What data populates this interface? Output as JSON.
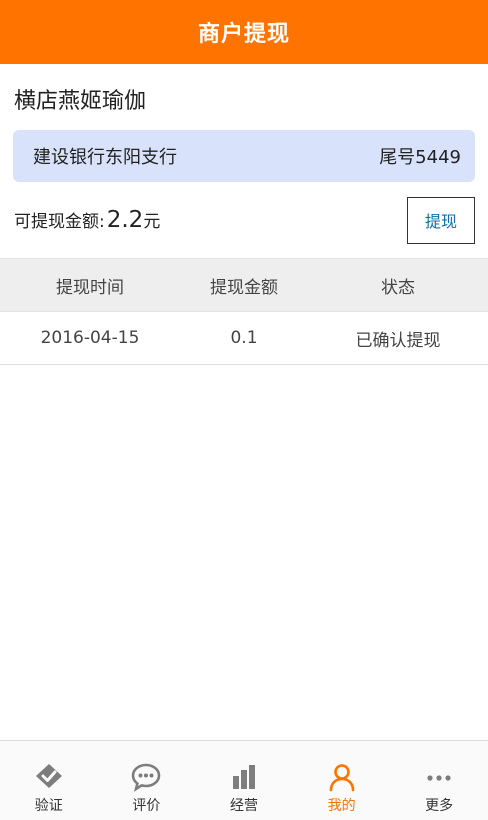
{
  "header": {
    "title": "商户提现"
  },
  "merchant": {
    "name": "横店燕姬瑜伽"
  },
  "bank": {
    "name": "建设银行东阳支行",
    "tail": "尾号5449"
  },
  "balance": {
    "label": "可提现金额:",
    "amount": "2.2",
    "unit": "元",
    "button_label": "提现"
  },
  "table": {
    "columns": [
      "提现时间",
      "提现金额",
      "状态"
    ],
    "rows": [
      {
        "time": "2016-04-15",
        "amount": "0.1",
        "status": "已确认提现"
      }
    ]
  },
  "tabbar": {
    "items": [
      {
        "label": "验证",
        "icon": "verify-icon",
        "active": false
      },
      {
        "label": "评价",
        "icon": "comment-icon",
        "active": false
      },
      {
        "label": "经营",
        "icon": "bar-chart-icon",
        "active": false
      },
      {
        "label": "我的",
        "icon": "person-icon",
        "active": true
      },
      {
        "label": "更多",
        "icon": "more-dots-icon",
        "active": false
      }
    ]
  },
  "colors": {
    "accent": "#ff7300",
    "card_bg": "#d8e3fb",
    "inactive_icon": "#7d7d7d"
  }
}
